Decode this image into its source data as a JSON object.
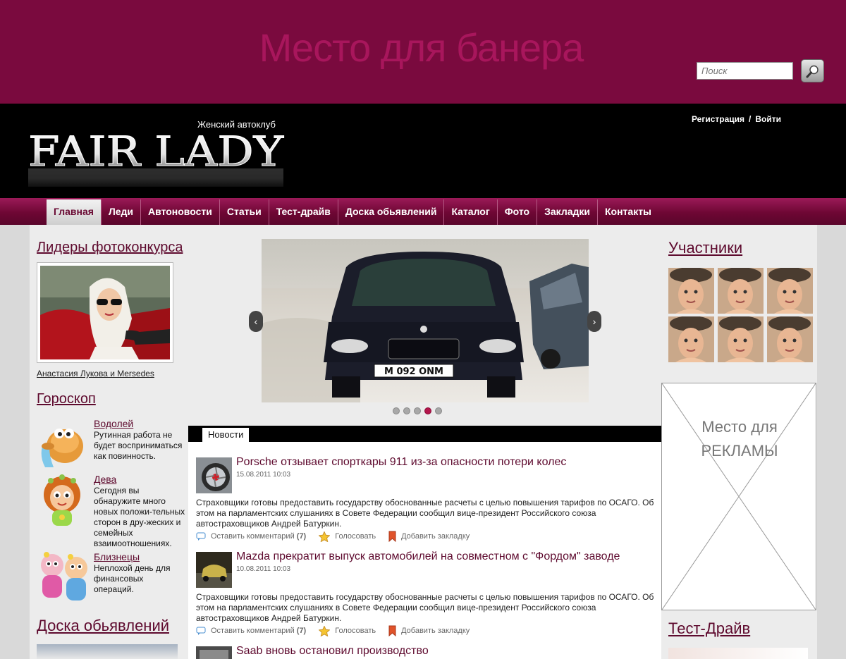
{
  "banner": {
    "text": "Место для банера"
  },
  "header": {
    "tagline": "Женский автоклуб",
    "logo_text": "FAIR LADY",
    "register": "Регистрация",
    "separator": "/",
    "login": "Войти",
    "search_placeholder": "Поиск"
  },
  "nav": {
    "items": [
      "Главная",
      "Леди",
      "Автоновости",
      "Статьи",
      "Тест-драйв",
      "Доска обьявлений",
      "Каталог",
      "Фото",
      "Закладки",
      "Контакты"
    ],
    "active": "Главная"
  },
  "left": {
    "contest_title": "Лидеры фотоконкурса",
    "contest_caption": "Анастасия Лукова и Mersedes",
    "horoscope_title": "Гороскоп",
    "horoscope": [
      {
        "sign": "Водолей",
        "text": "Рутинная работа не будет восприниматься как повинность."
      },
      {
        "sign": "Дева",
        "text": "Сегодня вы обнаружите много новых положи-тельных сторон в дру-жеских и семейных взаимоотношениях."
      },
      {
        "sign": "Близнецы",
        "text": "Неплохой день для финансовых операций."
      }
    ],
    "board_title": "Доска обьявлений"
  },
  "slider": {
    "plate": "M 092 ONM",
    "prev": "‹",
    "next": "›",
    "dots": 5,
    "active_dot": 4
  },
  "news": {
    "tab": "Новости",
    "items": [
      {
        "title": "Porsche отзывает спорткары 911 из-за опасности потери колес",
        "date": "15.08.2011 10:03",
        "body": "Страховщики готовы предоставить государству обоснованные расчеты с целью повышения тарифов по ОСАГО. Об этом на парламентских слушаниях в Совете Федерации сообщил вице-президент Российского союза автостраховщиков Андрей Батуркин."
      },
      {
        "title": "Mazda прекратит выпуск автомобилей на совместном с \"Фордом\" заводе",
        "date": "10.08.2011 10:03",
        "body": "Страховщики готовы предоставить государству обоснованные расчеты с целью повышения тарифов по ОСАГО. Об этом на парламентских слушаниях в Совете Федерации сообщил вице-президент Российского союза автостраховщиков Андрей Батуркин."
      },
      {
        "title": "Saab вновь остановил производство",
        "date": "",
        "body": ""
      }
    ],
    "comment_label": "Оставить комментарий",
    "comment_count": "(7)",
    "vote_label": "Голосовать",
    "bookmark_label": "Добавить закладку"
  },
  "right": {
    "members_title": "Участники",
    "ad_line1": "Место для",
    "ad_line2": "РЕКЛАМЫ",
    "testdrive_title": "Тест-Драйв"
  },
  "colors": {
    "brand": "#7a0a3e",
    "link": "#5e0a2e",
    "active_dot": "#b4164c"
  }
}
